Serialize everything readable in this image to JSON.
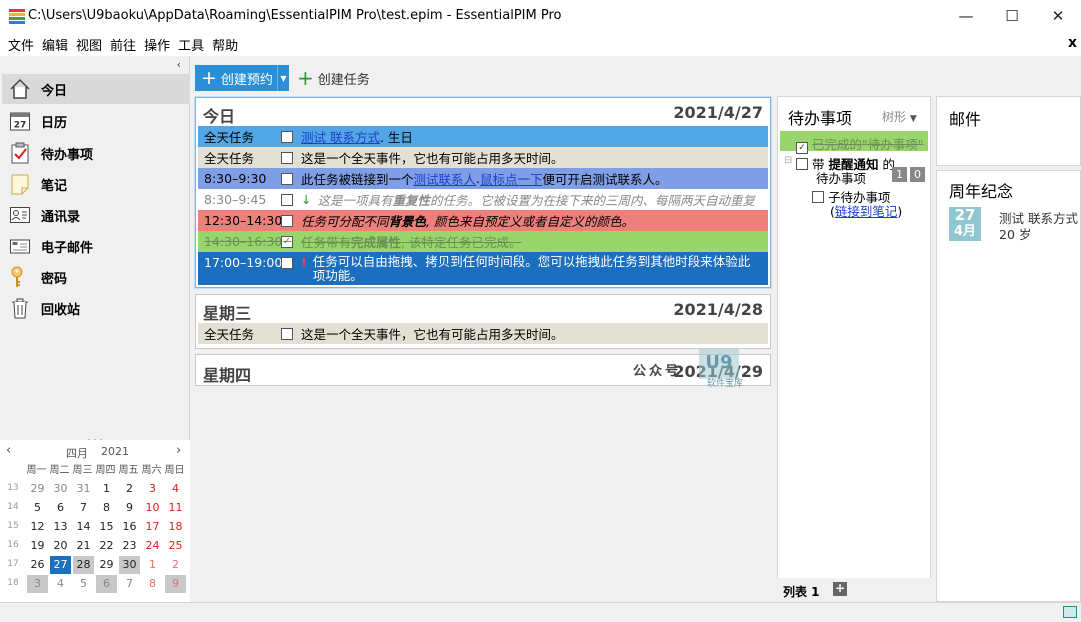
{
  "window": {
    "title": "C:\\Users\\U9baoku\\AppData\\Roaming\\EssentialPIM Pro\\test.epim - EssentialPIM Pro",
    "minimize": "—",
    "maximize": "☐",
    "close": "✕"
  },
  "menu": {
    "items": [
      "文件",
      "编辑",
      "视图",
      "前往",
      "操作",
      "工具",
      "帮助"
    ],
    "close_glyph": "x"
  },
  "nav": {
    "collapse_glyph": "‹",
    "items": [
      {
        "label": "今日",
        "icon": "home-icon"
      },
      {
        "label": "日历",
        "icon": "calendar-icon",
        "badge": "27"
      },
      {
        "label": "待办事项",
        "icon": "todo-check-icon"
      },
      {
        "label": "笔记",
        "icon": "note-icon"
      },
      {
        "label": "通讯录",
        "icon": "contacts-icon"
      },
      {
        "label": "电子邮件",
        "icon": "email-icon"
      },
      {
        "label": "密码",
        "icon": "key-icon"
      },
      {
        "label": "回收站",
        "icon": "trash-icon"
      }
    ],
    "splitter_dots": "•••"
  },
  "mini_calendar": {
    "month": "四月",
    "year": "2021",
    "prev": "‹",
    "next": "›",
    "weekdays": [
      "周一",
      "周二",
      "周三",
      "周四",
      "周五",
      "周六",
      "周日"
    ],
    "weeks": [
      "13",
      "14",
      "15",
      "16",
      "17",
      "18"
    ],
    "days": [
      [
        "29",
        "30",
        "31",
        "1",
        "2",
        "3",
        "4"
      ],
      [
        "5",
        "6",
        "7",
        "8",
        "9",
        "10",
        "11"
      ],
      [
        "12",
        "13",
        "14",
        "15",
        "16",
        "17",
        "18"
      ],
      [
        "19",
        "20",
        "21",
        "22",
        "23",
        "24",
        "25"
      ],
      [
        "26",
        "27",
        "28",
        "29",
        "30",
        "1",
        "2"
      ],
      [
        "3",
        "4",
        "5",
        "6",
        "7",
        "8",
        "9"
      ]
    ],
    "today": "27"
  },
  "toolbar": {
    "new_appointment": "创建预约",
    "new_task": "创建任务"
  },
  "today_view": {
    "days": [
      {
        "name": "今日",
        "date": "2021/4/27",
        "events": [
          {
            "time": "全天任务",
            "t1": "测试 联系方式",
            "t2": ". 生日"
          },
          {
            "time": "全天任务",
            "t1": "这是一个全天事件，它也有可能占用多天时间。"
          },
          {
            "time": "8:30–9:30",
            "t1": "此任务被链接到一个 ",
            "l1": "测试联系人",
            "t2": ". ",
            "l2": "鼠标点一下",
            "t3": " 便可开启测试联系人。"
          },
          {
            "time": "8:30–9:45",
            "t1": "这是一项具有",
            "b1": "重复性",
            "t2": "的任务。它被设置为在接下来的三周内、每隔两天自动重复"
          },
          {
            "time": "12:30–14:30",
            "t1": "任务可分配不同 ",
            "b1": "背景色",
            "t2": ", 颜色来自预定义或者自定义的颜色。"
          },
          {
            "time": "14:30–16:30",
            "t1": "任务带有 ",
            "b1": "完成属性",
            "t2": ", 该特定任务已完成。"
          },
          {
            "time": "17:00–19:00",
            "mark": "!",
            "t1": "任务可以自由拖拽、拷贝到任何时间段。您可以拖拽此任务到其他时段来体验此",
            "t2": "项功能。"
          }
        ]
      },
      {
        "name": "星期三",
        "date": "2021/4/28",
        "events": [
          {
            "time": "全天任务",
            "t1": "这是一个全天事件，它也有可能占用多天时间。"
          }
        ]
      },
      {
        "name": "星期四",
        "date": "2021/4/29",
        "events": []
      }
    ],
    "watermark": {
      "text": "公众号",
      "logo": "U9",
      "sub": "软件宝库"
    }
  },
  "todo": {
    "title": "待办事项",
    "view_mode": "树形",
    "items": [
      {
        "label": "已完成的\"待办事项\""
      },
      {
        "pre": "带 ",
        "bold": "提醒通知",
        "post": " 的",
        "line2": "待办事项",
        "count1": "1",
        "count2": "0"
      },
      {
        "label": "子待办事项",
        "link_pre": "(",
        "link": "链接到笔记",
        "link_post": ")"
      }
    ],
    "list_tab": "列表 1",
    "add_tab": "+"
  },
  "right": {
    "mail_title": "邮件",
    "anniv_title": "周年纪念",
    "anniv_day": "27",
    "anniv_month": "4月",
    "anniv_name": "测试 联系方式",
    "anniv_age": "20 岁"
  },
  "colors": {
    "row_allday": "#e2e0d2",
    "row_birthday": "#53a6e6",
    "row_link": "#7f9ee6",
    "row_recurring": "#ffffff",
    "row_bg": "#ee7f7b",
    "row_done": "#98d56b",
    "row_drag": "#1c6fbf",
    "today_blue": "#1c6fbf",
    "anniv_tile": "#8ec6d1"
  }
}
